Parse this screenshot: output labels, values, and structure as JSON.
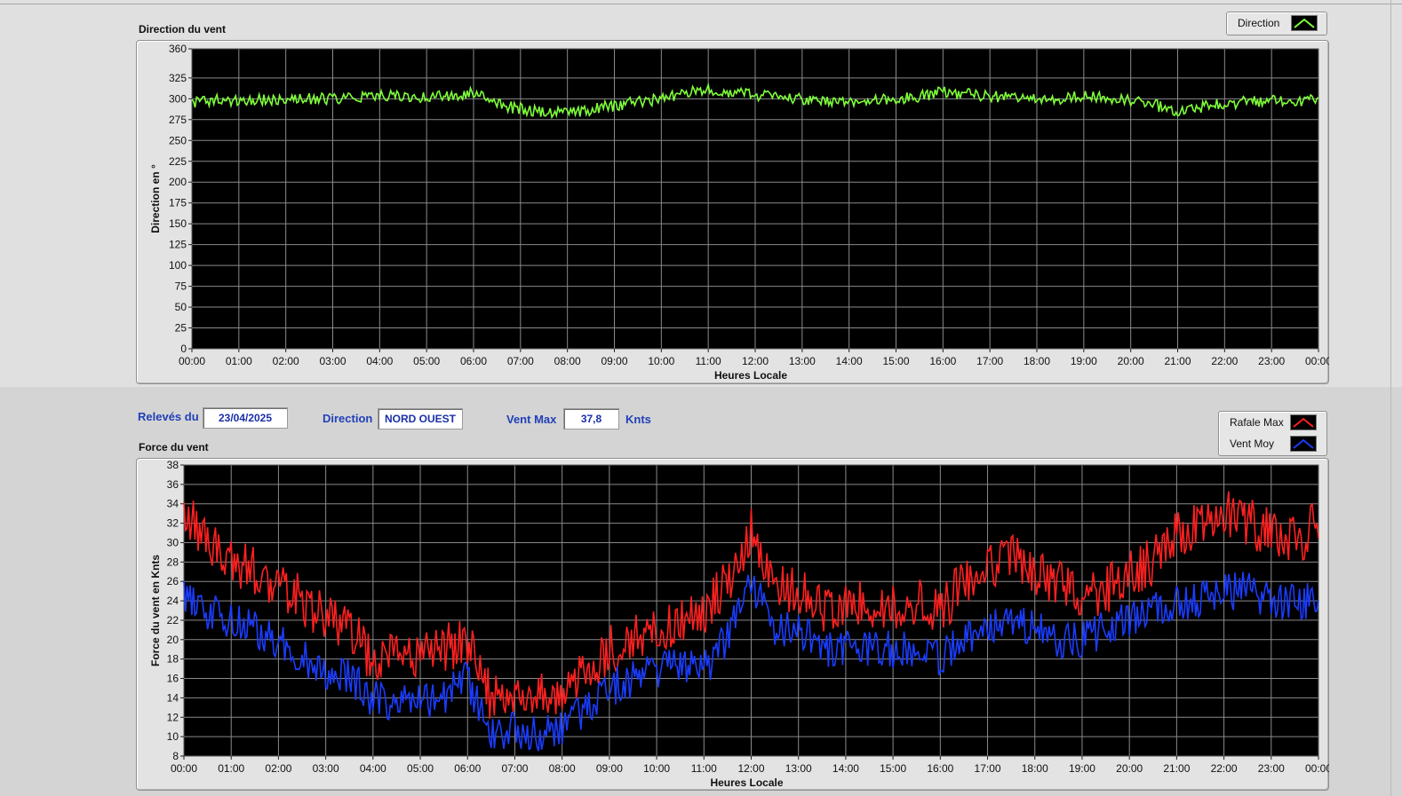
{
  "controls": {
    "releves_label": "Relevés du",
    "releves_value": "23/04/2025",
    "direction_label": "Direction",
    "direction_value": "NORD OUEST",
    "ventmax_label": "Vent Max",
    "ventmax_value": "37,8",
    "ventmax_unit": "Knts"
  },
  "chart_data": [
    {
      "type": "line",
      "title": "Direction du vent",
      "xlabel": "Heures Locale",
      "ylabel": "Direction en °",
      "ylim": [
        0,
        360
      ],
      "yticks": [
        0,
        25,
        50,
        75,
        100,
        125,
        150,
        175,
        200,
        225,
        250,
        275,
        300,
        325,
        360
      ],
      "xticks": [
        "00:00",
        "01:00",
        "02:00",
        "03:00",
        "04:00",
        "05:00",
        "06:00",
        "07:00",
        "08:00",
        "09:00",
        "10:00",
        "11:00",
        "12:00",
        "13:00",
        "14:00",
        "15:00",
        "16:00",
        "17:00",
        "18:00",
        "19:00",
        "20:00",
        "21:00",
        "22:00",
        "23:00",
        "00:00"
      ],
      "grid": true,
      "background": "#000000",
      "legend": "top-right",
      "series": [
        {
          "name": "Direction",
          "color": "#7fff3a",
          "x_hours": [
            0,
            0.5,
            1,
            1.5,
            2,
            2.5,
            3,
            3.5,
            4,
            4.5,
            5,
            5.5,
            6,
            6.5,
            7,
            7.5,
            8,
            8.5,
            9,
            9.5,
            10,
            10.5,
            11,
            11.5,
            12,
            12.5,
            13,
            13.5,
            14,
            14.5,
            15,
            15.5,
            16,
            16.5,
            17,
            17.5,
            18,
            18.5,
            19,
            19.5,
            20,
            20.5,
            21,
            21.5,
            22,
            22.5,
            23,
            23.5,
            24
          ],
          "values": [
            296,
            298,
            297,
            299,
            298,
            300,
            300,
            302,
            305,
            303,
            302,
            304,
            308,
            293,
            288,
            285,
            282,
            287,
            292,
            296,
            300,
            306,
            312,
            307,
            304,
            302,
            299,
            298,
            298,
            298,
            299,
            303,
            308,
            306,
            303,
            302,
            301,
            300,
            303,
            301,
            297,
            292,
            286,
            290,
            294,
            297,
            297,
            298,
            298
          ]
        }
      ]
    },
    {
      "type": "line",
      "title": "Force du vent",
      "xlabel": "Heures Locale",
      "ylabel": "Force du vent en Knts",
      "ylim": [
        8,
        38
      ],
      "yticks": [
        8,
        10,
        12,
        14,
        16,
        18,
        20,
        22,
        24,
        26,
        28,
        30,
        32,
        34,
        36,
        38
      ],
      "xticks": [
        "00:00",
        "01:00",
        "02:00",
        "03:00",
        "04:00",
        "05:00",
        "06:00",
        "07:00",
        "08:00",
        "09:00",
        "10:00",
        "11:00",
        "12:00",
        "13:00",
        "14:00",
        "15:00",
        "16:00",
        "17:00",
        "18:00",
        "19:00",
        "20:00",
        "21:00",
        "22:00",
        "23:00",
        "00:00"
      ],
      "grid": true,
      "background": "#000000",
      "legend": "top-right",
      "series": [
        {
          "name": "Rafale Max",
          "color": "#ff2020",
          "x_hours": [
            0,
            0.5,
            1,
            1.5,
            2,
            2.5,
            3,
            3.5,
            4,
            4.5,
            5,
            5.5,
            6,
            6.5,
            7,
            7.5,
            8,
            8.5,
            9,
            9.5,
            10,
            10.5,
            11,
            11.5,
            12,
            12.5,
            13,
            13.5,
            14,
            14.5,
            15,
            15.5,
            16,
            16.5,
            17,
            17.5,
            18,
            18.5,
            19,
            19.5,
            20,
            20.5,
            21,
            21.5,
            22,
            22.5,
            23,
            23.5,
            24
          ],
          "values": [
            33,
            30,
            28,
            27,
            26,
            24,
            22,
            21,
            18,
            18,
            19,
            19,
            20,
            14,
            14,
            14,
            14,
            17,
            19,
            20,
            21,
            22,
            23,
            26,
            31,
            26,
            25,
            23,
            24,
            24,
            23,
            24,
            23,
            26,
            27,
            29,
            27,
            26,
            24,
            25,
            27,
            28,
            31,
            32,
            33,
            32,
            31,
            30,
            32
          ]
        },
        {
          "name": "Vent Moy",
          "color": "#1a3cff",
          "x_hours": [
            0,
            0.5,
            1,
            1.5,
            2,
            2.5,
            3,
            3.5,
            4,
            4.5,
            5,
            5.5,
            6,
            6.5,
            7,
            7.5,
            8,
            8.5,
            9,
            9.5,
            10,
            10.5,
            11,
            11.5,
            12,
            12.5,
            13,
            13.5,
            14,
            14.5,
            15,
            15.5,
            16,
            16.5,
            17,
            17.5,
            18,
            18.5,
            19,
            19.5,
            20,
            20.5,
            21,
            21.5,
            22,
            22.5,
            23,
            23.5,
            24
          ],
          "values": [
            25,
            23,
            22,
            21,
            20,
            18,
            17,
            16,
            14,
            13,
            14,
            14,
            16,
            10,
            11,
            10,
            11,
            13,
            15,
            16,
            17,
            17,
            17,
            20,
            26,
            21,
            21,
            19,
            19,
            19,
            19,
            19,
            18,
            20,
            21,
            22,
            21,
            20,
            20,
            21,
            22,
            23,
            24,
            24,
            25,
            25,
            24,
            24,
            24
          ]
        }
      ]
    }
  ]
}
